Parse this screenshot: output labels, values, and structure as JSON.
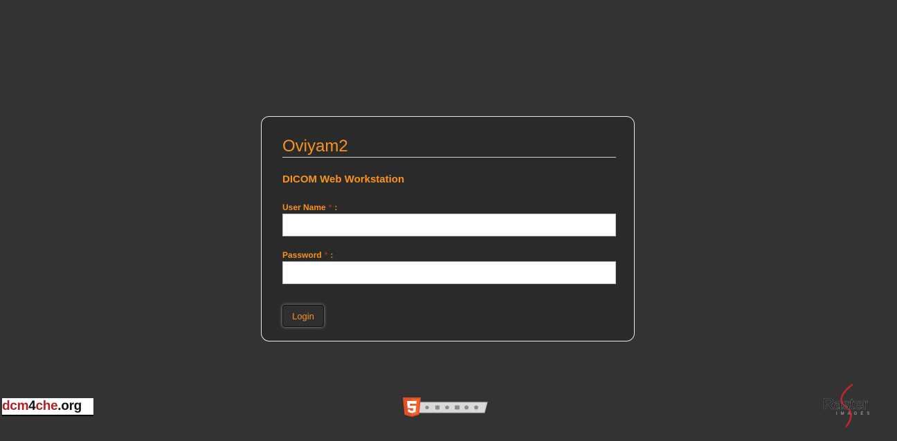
{
  "login": {
    "title": "Oviyam2",
    "subtitle": "DICOM Web Workstation",
    "username_label": "User Name",
    "password_label": "Password",
    "required_marker": "*",
    "label_suffix": ":",
    "username_value": "",
    "password_value": "",
    "login_button": "Login"
  },
  "footer": {
    "dcm_logo": {
      "dcm": "dcm",
      "four": "4",
      "che": "che",
      "org": ".org"
    },
    "html5_icon": "html5-badge-icon",
    "raster_logo_text": "Raster",
    "raster_logo_sub": "IMAGES"
  },
  "colors": {
    "background": "#333333",
    "accent": "#f7931e",
    "required": "#c0392b"
  }
}
